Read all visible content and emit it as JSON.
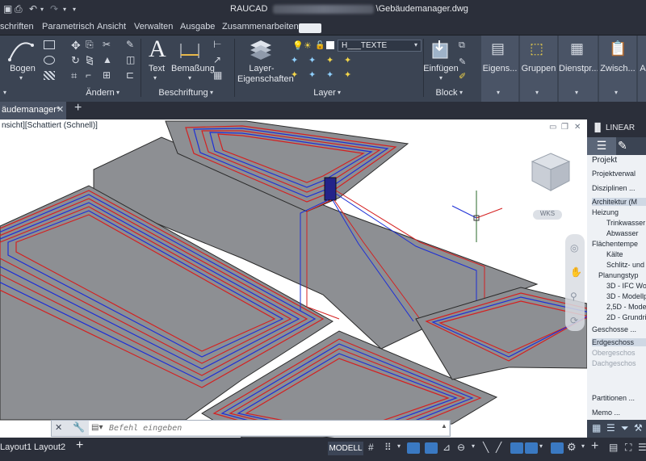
{
  "titlebar": {
    "app": "RAUCAD",
    "file": "\\Gebäudemanager.dwg"
  },
  "menu": [
    "schriften",
    "Parametrisch",
    "Ansicht",
    "Verwalten",
    "Ausgabe",
    "Zusammenarbeiten"
  ],
  "ribbon": {
    "bogen": "Bogen",
    "aendern": "Ändern",
    "text": "Text",
    "bemassung": "Bemaßung",
    "beschriftung": "Beschriftung",
    "layer_props_1": "Layer-",
    "layer_props_2": "Eigenschaften",
    "layer_name": "H___TEXTE",
    "layer": "Layer",
    "einfuegen": "Einfügen",
    "block": "Block",
    "eigens": "Eigens...",
    "gruppen": "Gruppen",
    "dienstpr": "Dienstpr...",
    "zwisch": "Zwisch...",
    "a": "A"
  },
  "doctab": "äudemanager*",
  "viewport_label": "nsicht][Schattiert (Schnell)]",
  "viewcube": {
    "wks": "WKS"
  },
  "rightpanel": {
    "title": "LINEAR",
    "projekt": "Projekt",
    "items": [
      "Projektverwal",
      "Disziplinen ...",
      "Architektur (M",
      "Heizung",
      "Trinkwasser",
      "Abwasser",
      "Flächentempe",
      "Kälte",
      "Schlitz- und D",
      "Planungstyp",
      "3D - IFC Wor",
      "3D - Modellpl",
      "2,5D - Modell",
      "2D - Grundris",
      "Geschosse ...",
      "Erdgeschoss",
      "Obergeschos",
      "Dachgeschos",
      "Partitionen ...",
      "Memo ..."
    ]
  },
  "command": {
    "placeholder": "Befehl eingeben"
  },
  "layouts": [
    "Layout1",
    "Layout2"
  ],
  "status": {
    "model": "MODELL"
  },
  "colors": {
    "supply": "#d42020",
    "return": "#1d2fd6",
    "slab": "#8d8f93"
  }
}
